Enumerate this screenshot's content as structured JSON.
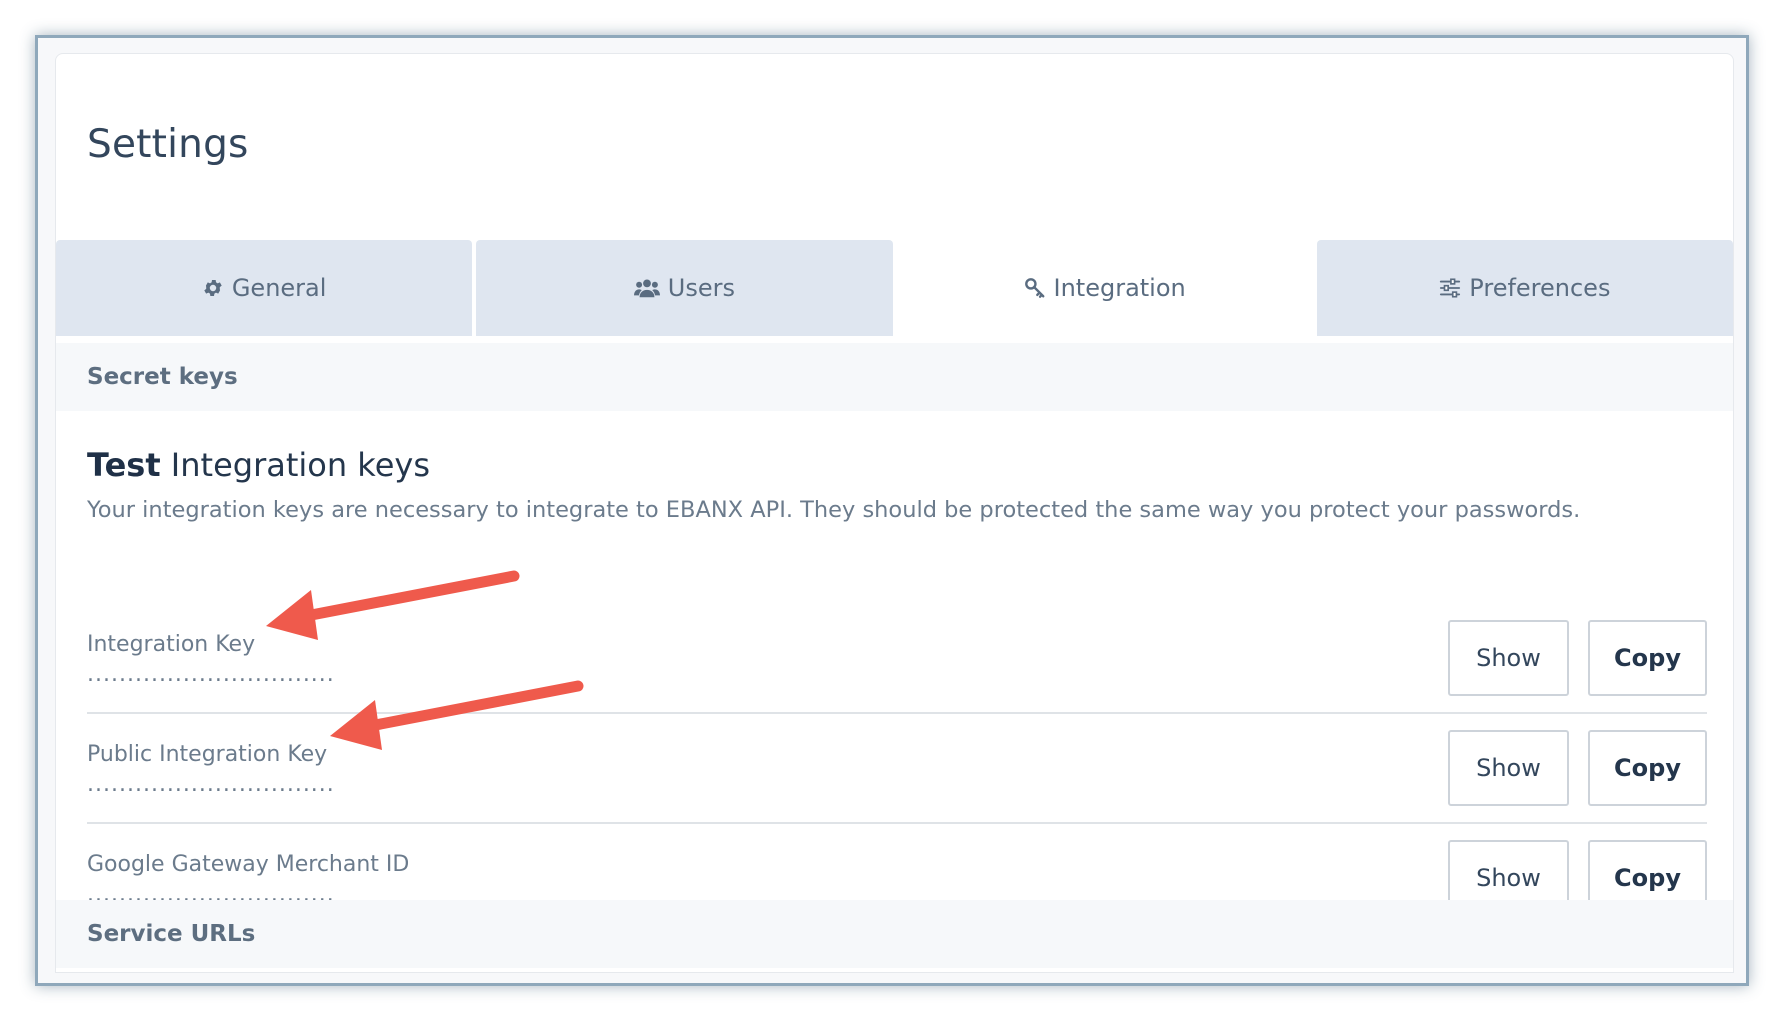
{
  "page": {
    "title": "Settings"
  },
  "tabs": [
    {
      "label": "General",
      "icon": "gear-icon",
      "active": false
    },
    {
      "label": "Users",
      "icon": "users-icon",
      "active": false
    },
    {
      "label": "Integration",
      "icon": "key-icon",
      "active": true
    },
    {
      "label": "Preferences",
      "icon": "sliders-icon",
      "active": false
    }
  ],
  "sections": {
    "secret_keys": "Secret keys",
    "service_urls": "Service URLs"
  },
  "integration_keys": {
    "heading_strong": "Test",
    "heading_rest": " Integration keys",
    "description": "Your integration keys are necessary to integrate to EBANX API. They should be protected the same way you protect your passwords.",
    "show_label": "Show",
    "copy_label": "Copy",
    "rows": [
      {
        "label": "Integration Key",
        "masked": "..............................."
      },
      {
        "label": "Public Integration Key",
        "masked": "..............................."
      },
      {
        "label": "Google Gateway Merchant ID",
        "masked": "..............................."
      }
    ]
  },
  "annotations": {
    "arrow_color": "#ef5a4c"
  },
  "colors": {
    "tab_inactive_bg": "#dfe6f0",
    "tab_active_bg": "#ffffff",
    "title_text": "#33465c",
    "muted_text": "#6b7b8c",
    "frame_border": "#8fa8bb"
  }
}
